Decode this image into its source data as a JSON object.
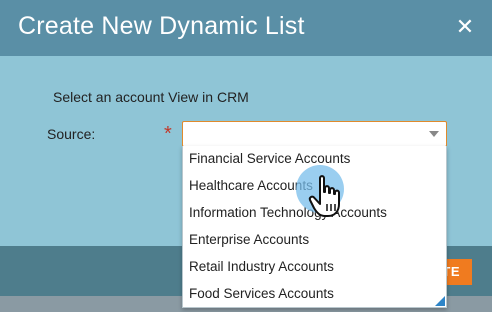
{
  "dialog": {
    "title": "Create New Dynamic List",
    "close_icon": "close-icon",
    "instruction": "Select an account View in CRM",
    "source_label": "Source:",
    "required_marker": "*",
    "source_value": ""
  },
  "dropdown": {
    "options": [
      "Financial Service Accounts",
      "Healthcare Accounts",
      "Information Technology Accounts",
      "Enterprise Accounts",
      "Retail Industry Accounts",
      "Food Services Accounts"
    ],
    "hovered_index": 1
  },
  "footer": {
    "create_label_visible": "TE"
  },
  "colors": {
    "titlebar": "#5a8fa6",
    "body": "#8fc5d6",
    "footer": "#4e7d8c",
    "accent": "#f07b1f",
    "required": "#c0392b"
  },
  "icons": {
    "cursor": "hand-pointer-icon"
  }
}
